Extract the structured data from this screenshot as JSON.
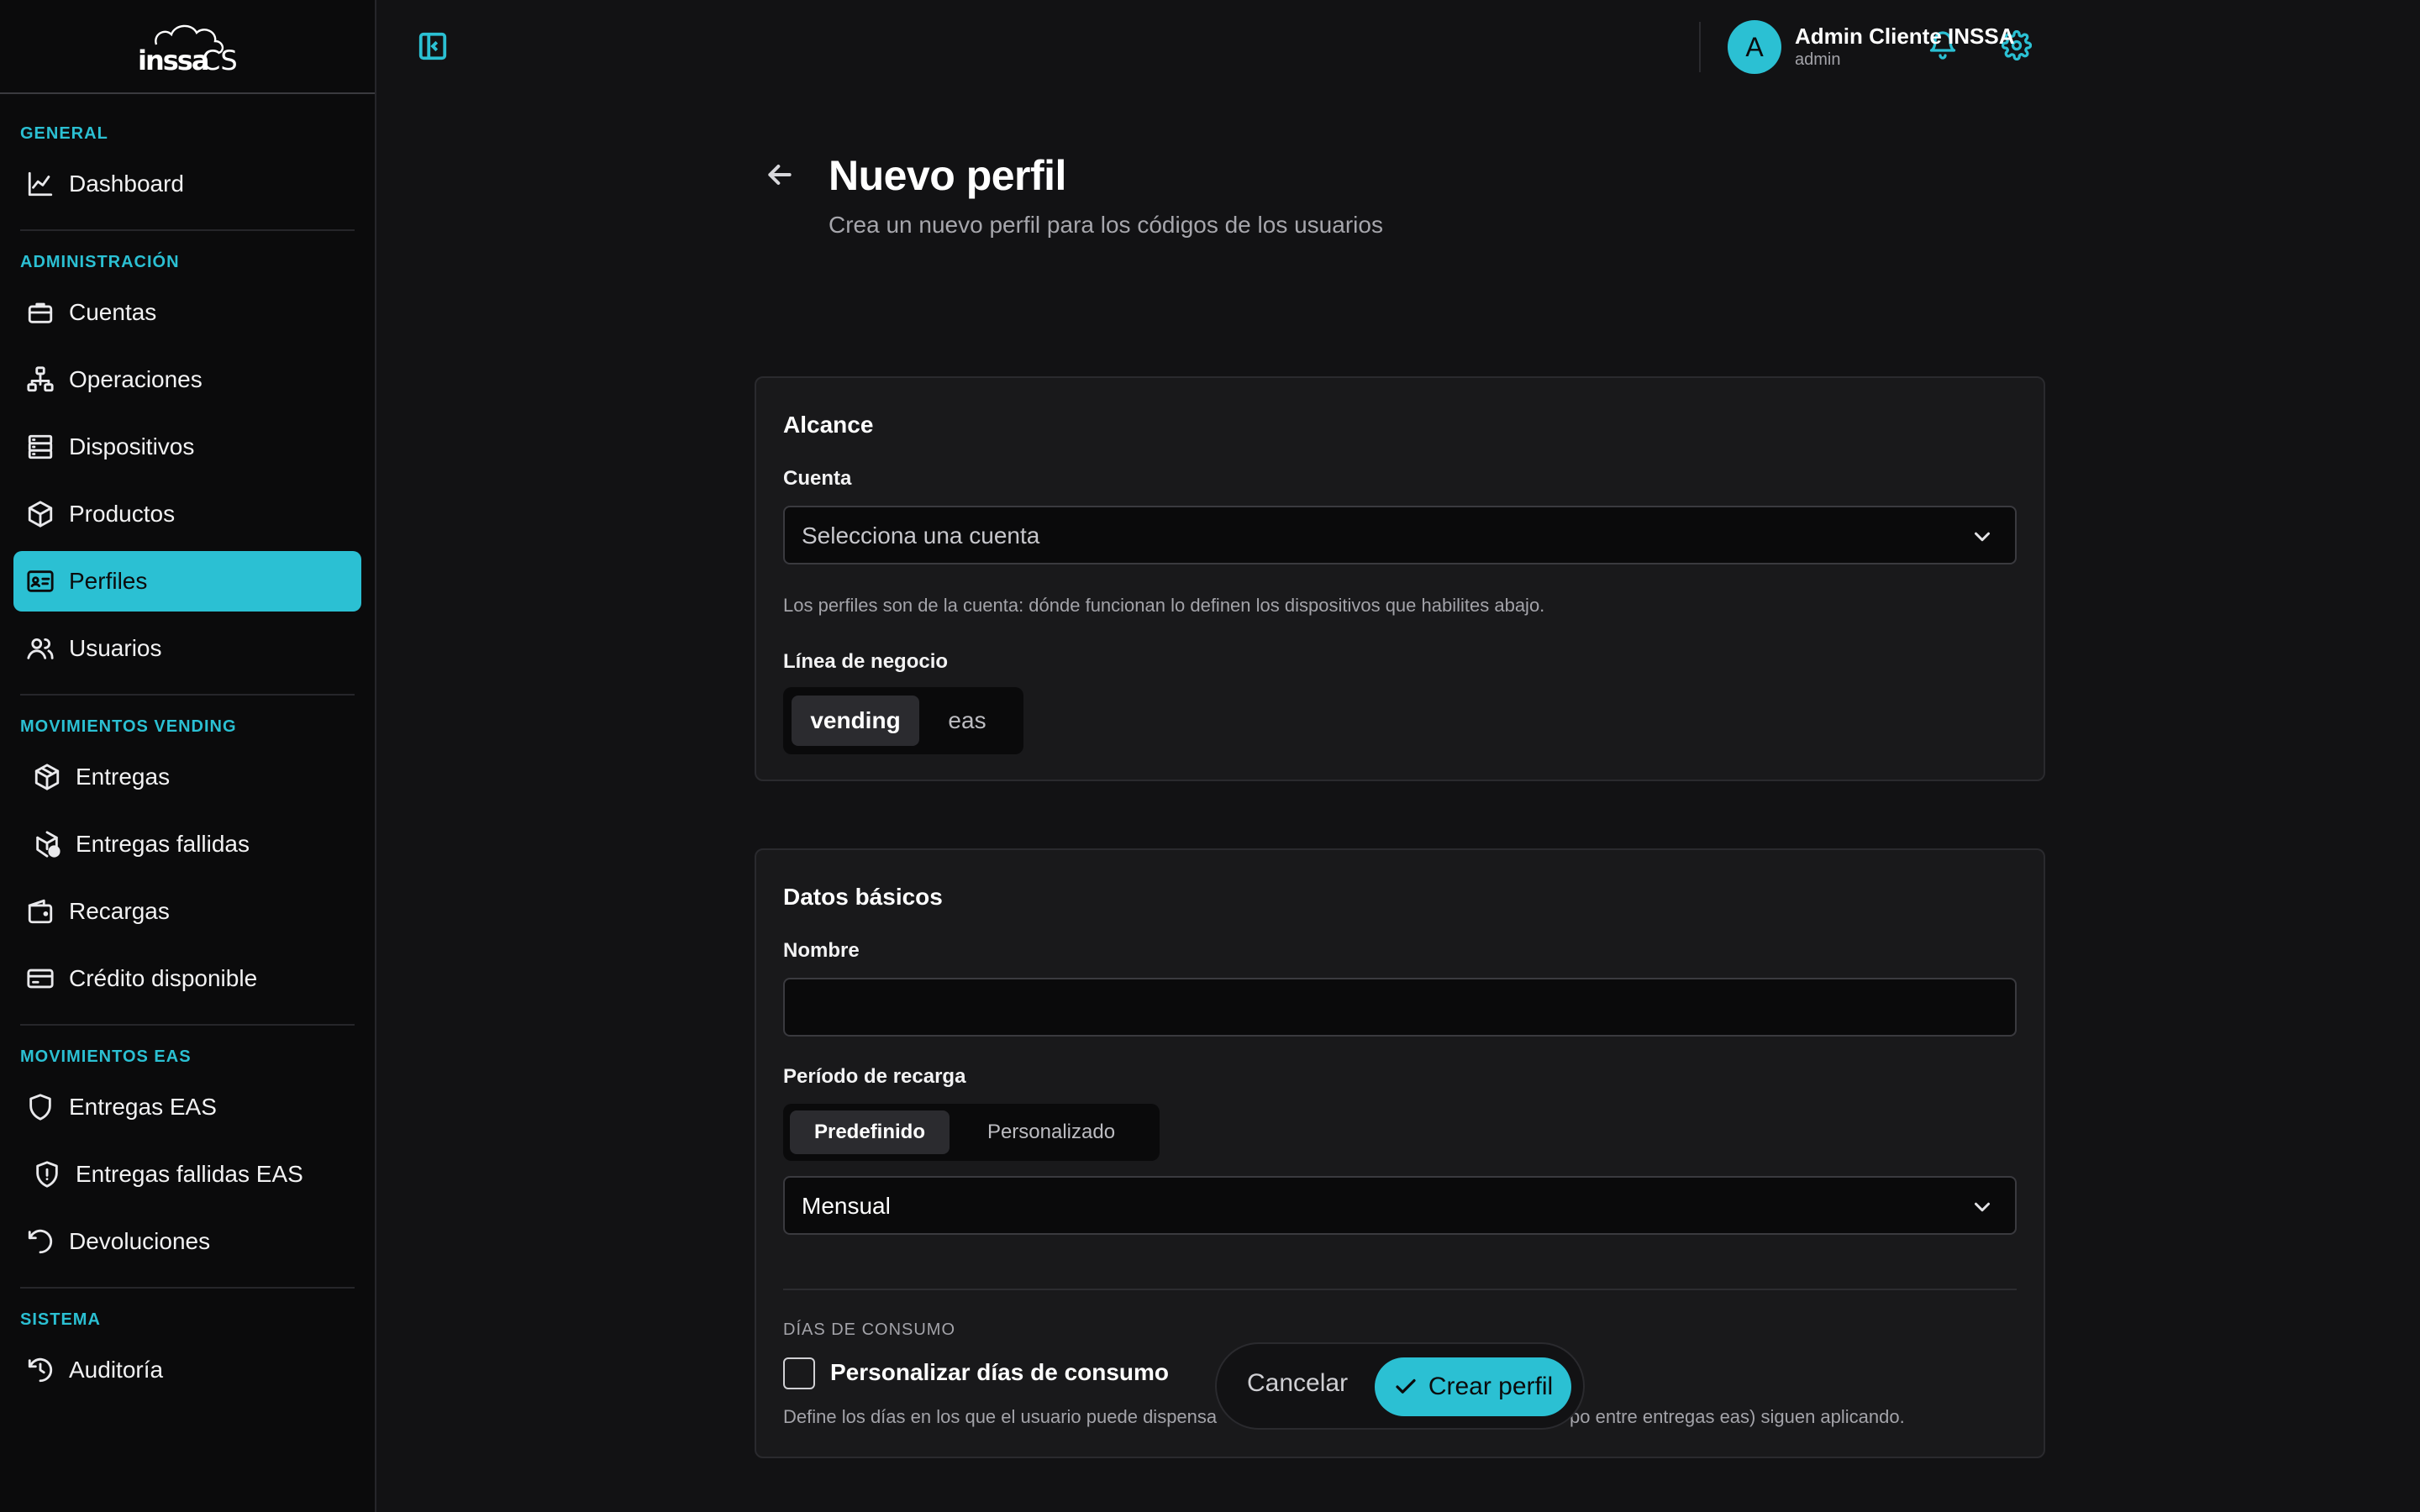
{
  "brand": {
    "logo_text": "inssa CS",
    "accent": "#2bc0d3"
  },
  "sidebar": {
    "sections": [
      {
        "title": "GENERAL",
        "items": [
          {
            "label": "Dashboard",
            "icon": "chart-line-icon"
          }
        ]
      },
      {
        "title": "ADMINISTRACIÓN",
        "items": [
          {
            "label": "Cuentas",
            "icon": "briefcase-icon"
          },
          {
            "label": "Operaciones",
            "icon": "network-icon"
          },
          {
            "label": "Dispositivos",
            "icon": "server-icon"
          },
          {
            "label": "Productos",
            "icon": "package-icon"
          },
          {
            "label": "Perfiles",
            "icon": "id-card-icon",
            "active": true
          },
          {
            "label": "Usuarios",
            "icon": "users-icon"
          }
        ]
      },
      {
        "title": "MOVIMIENTOS VENDING",
        "items": [
          {
            "label": "Entregas",
            "icon": "box-icon"
          },
          {
            "label": "Entregas fallidas",
            "icon": "box-alert-icon"
          },
          {
            "label": "Recargas",
            "icon": "wallet-icon"
          },
          {
            "label": "Crédito disponible",
            "icon": "credit-card-icon"
          }
        ]
      },
      {
        "title": "MOVIMIENTOS EAS",
        "items": [
          {
            "label": "Entregas EAS",
            "icon": "shield-icon"
          },
          {
            "label": "Entregas fallidas EAS",
            "icon": "shield-alert-icon"
          },
          {
            "label": "Devoluciones",
            "icon": "rotate-ccw-icon"
          }
        ]
      },
      {
        "title": "SISTEMA",
        "items": [
          {
            "label": "Auditoría",
            "icon": "history-icon"
          }
        ]
      }
    ]
  },
  "topbar": {
    "user": {
      "initial": "A",
      "name": "Admin Cliente INSSA",
      "role": "admin"
    }
  },
  "header": {
    "title": "Nuevo perfil",
    "subtitle": "Crea un nuevo perfil para los códigos de los usuarios"
  },
  "alcance": {
    "title": "Alcance",
    "cuenta_label": "Cuenta",
    "cuenta_placeholder": "Selecciona una cuenta",
    "helper": "Los perfiles son de la cuenta: dónde funcionan lo definen los dispositivos que habilites abajo.",
    "linea_label": "Línea de negocio",
    "linea_options": [
      "vending",
      "eas"
    ],
    "linea_selected": "vending"
  },
  "datos": {
    "title": "Datos básicos",
    "nombre_label": "Nombre",
    "nombre_value": "",
    "periodo_label": "Período de recarga",
    "periodo_options": [
      "Predefinido",
      "Personalizado"
    ],
    "periodo_selected": "Predefinido",
    "periodo_value": "Mensual",
    "dias_section": "DÍAS DE CONSUMO",
    "dias_checkbox": "Personalizar días de consumo",
    "dias_checked": false,
    "dias_helper_left": "Define los días en los que el usuario puede dispensa",
    "dias_helper_right": "po entre entregas eas) siguen aplicando."
  },
  "actions": {
    "cancel": "Cancelar",
    "create": "Crear perfil"
  }
}
